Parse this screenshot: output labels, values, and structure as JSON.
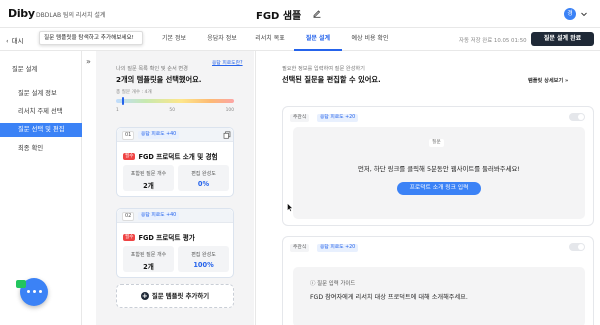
{
  "header": {
    "logo": "Diby",
    "project": "DBDLAB 팀의 리서치 설계",
    "doc_title": "FGD 샘플",
    "avatar_initial": "경"
  },
  "nav": {
    "back_label": "대시",
    "tooltip": "질문 템플릿을 탐색하고 추가해보세요!",
    "tabs": [
      "기본 정보",
      "응답자 정보",
      "리서치 목표",
      "질문 설계",
      "예상 비용 확인"
    ],
    "active_tab_index": 3,
    "autosave": "자동 저장 완료 10.05 01:50",
    "complete_button": "질문 설계 완료"
  },
  "sidebar": {
    "heading": "질문 설계",
    "items": [
      "질문 설계 정보",
      "리서치 주제 선택",
      "질문 선택 및 편집",
      "최종 확인"
    ],
    "active_index": 2
  },
  "middle": {
    "subtitle": "나의 질문 목록 확인 및 순서 변경",
    "title": "2개의 템플릿을 선택했어요.",
    "link": "응답 피로도란?",
    "count_label": "총 질문 개수 : 4개",
    "gauge": {
      "ticks": [
        "1",
        "50",
        "100"
      ],
      "level": 0.05
    },
    "cards": [
      {
        "num": "01",
        "fit": "응답 피로도 +40",
        "badge": "필수",
        "title": "FGD 프로덕트 소개 및 경험",
        "stat1_label": "포함된 질문 개수",
        "stat1_value": "2개",
        "stat2_label": "편집 완성도",
        "stat2_value": "0%"
      },
      {
        "num": "02",
        "fit": "응답 피로도 +40",
        "badge": "필수",
        "title": "FGD 프로덕트 평가",
        "stat1_label": "포함된 질문 개수",
        "stat1_value": "2개",
        "stat2_label": "편집 완성도",
        "stat2_value": "100%"
      }
    ],
    "add_button": "질문 템플릿 추가하기"
  },
  "right": {
    "subtitle": "필요한 정보를 입력하여 질문 완성하기",
    "title": "선택된 질문을 편집할 수 있어요.",
    "link": "템플릿 상세보기",
    "q1": {
      "chip": "주관식",
      "fit": "응답 피로도 +20",
      "label": "질문",
      "instruction": "먼저, 하단 링크를 클릭해 5분동안 웹사이트를 둘러봐주세요!",
      "button": "프로덕트 소개 링크 입력"
    },
    "q2": {
      "chip": "주관식",
      "fit": "응답 피로도 +20",
      "guide_title": "질문 입력 가이드",
      "guide_text": "FGD 참여자에게 리서치 대상 프로덕트에 대해 소개해주세요."
    }
  },
  "colors": {
    "accent": "#3b82f6",
    "dark_button": "#1f2937",
    "required_badge": "#ef4444"
  }
}
